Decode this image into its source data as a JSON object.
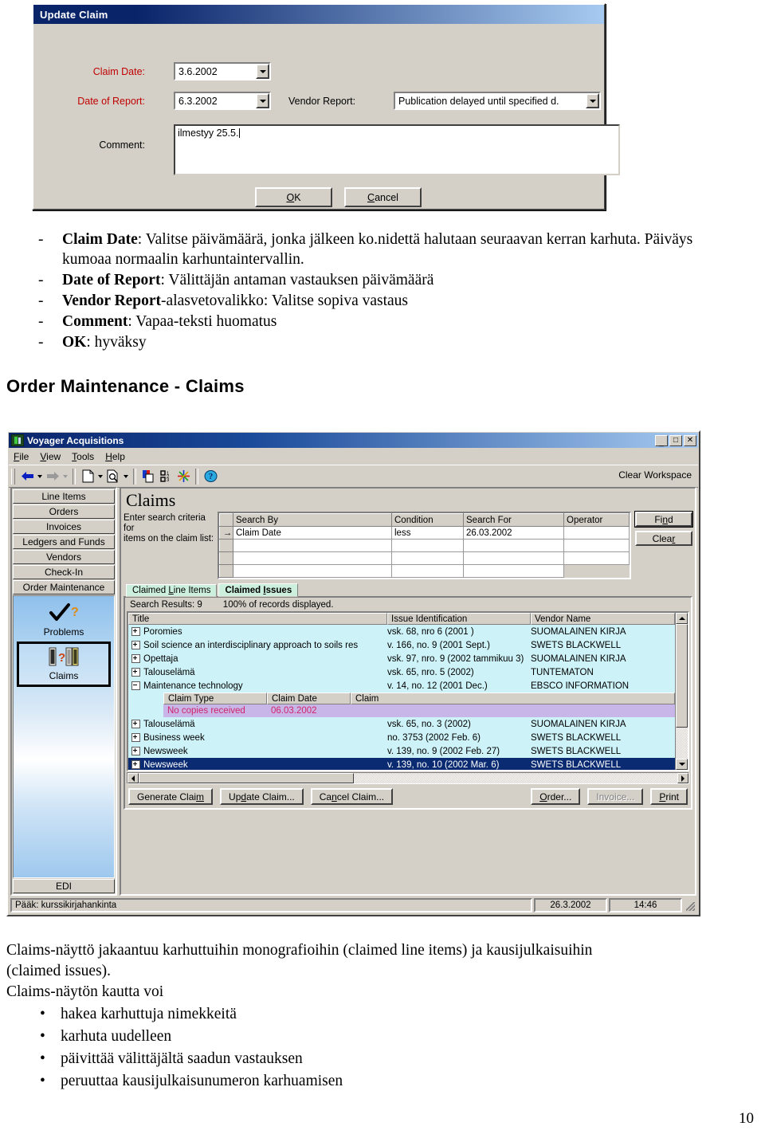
{
  "dialog": {
    "title": "Update Claim",
    "claim_date_label": "Claim Date:",
    "claim_date_value": "3.6.2002",
    "date_of_report_label": "Date of Report:",
    "date_of_report_value": "6.3.2002",
    "vendor_report_label": "Vendor Report:",
    "vendor_report_value": "Publication delayed until specified d.",
    "comment_label": "Comment:",
    "comment_value": "ilmestyy 25.5.",
    "ok_label": "OK",
    "cancel_label": "Cancel"
  },
  "doc_bullets": [
    {
      "dash": "-",
      "bold": "Claim Date",
      "rest": ": Valitse päivämäärä, jonka jälkeen ko.nidettä halutaan seuraavan kerran karhuta. Päiväys kumoaa normaalin karhuntaintervallin."
    },
    {
      "dash": "-",
      "bold": "Date of Report",
      "rest": ": Välittäjän antaman vastauksen päivämäärä"
    },
    {
      "dash": "-",
      "bold": "Vendor Report",
      "rest": "-alasvetovalikko: Valitse sopiva vastaus"
    },
    {
      "dash": "-",
      "bold": "Comment",
      "rest": ": Vapaa-teksti huomatus"
    },
    {
      "dash": "-",
      "bold": "OK",
      "rest": ": hyväksy"
    }
  ],
  "section_heading": "Order Maintenance - Claims",
  "app": {
    "title": "Voyager Acquisitions",
    "window_buttons": {
      "minimize": "_",
      "maximize": "□",
      "close": "✕"
    },
    "menus": [
      "File",
      "View",
      "Tools",
      "Help"
    ],
    "toolbar": {
      "clear_workspace": "Clear Workspace",
      "icons": [
        "back-arrow-icon",
        "forward-arrow-icon",
        "new-record-icon",
        "search-record-icon",
        "copy-record-icon",
        "barcode-icon",
        "asterisk-icon",
        "help-icon"
      ]
    },
    "sidebar": {
      "buttons": [
        "Line Items",
        "Orders",
        "Invoices",
        "Ledgers and Funds",
        "Vendors",
        "Check-In",
        "Order Maintenance"
      ],
      "tiles": [
        {
          "label": "Problems",
          "selected": false
        },
        {
          "label": "Claims",
          "selected": true
        }
      ],
      "edi_label": "EDI"
    },
    "heading": "Claims",
    "search": {
      "hint_line1": "Enter search criteria for",
      "hint_line2": "items on the claim list:",
      "columns": [
        "Search By",
        "Condition",
        "Search For",
        "Operator"
      ],
      "rows": [
        {
          "marker": "→",
          "search_by": "Claim Date",
          "condition": "less",
          "search_for": "26.03.2002",
          "operator": ""
        },
        {
          "marker": "",
          "search_by": "",
          "condition": "",
          "search_for": "",
          "operator": ""
        },
        {
          "marker": "",
          "search_by": "",
          "condition": "",
          "search_for": "",
          "operator": ""
        },
        {
          "marker": "",
          "search_by": "",
          "condition": "",
          "search_for": "",
          "operator": ""
        }
      ],
      "find_label": "Find",
      "clear_label": "Clear"
    },
    "tabs": [
      {
        "label": "Claimed Line Items",
        "active": false
      },
      {
        "label": "Claimed Issues",
        "active": true
      }
    ],
    "results": {
      "label": "Search Results:",
      "count": "9",
      "percent_text": "100% of records displayed.",
      "columns": [
        "Title",
        "Issue Identification",
        "Vendor Name"
      ],
      "rows": [
        {
          "expanded": false,
          "title": "Poromies",
          "issue": "vsk. 68, nro 6 (2001 )",
          "vendor": "SUOMALAINEN KIRJA",
          "selected": false
        },
        {
          "expanded": false,
          "title": "Soil science an interdisciplinary approach to soils res",
          "issue": "v. 166, no. 9 (2001 Sept.)",
          "vendor": "SWETS BLACKWELL",
          "selected": false
        },
        {
          "expanded": false,
          "title": "Opettaja",
          "issue": "vsk. 97, nro. 9 (2002 tammikuu 3)",
          "vendor": "SUOMALAINEN KIRJA",
          "selected": false
        },
        {
          "expanded": false,
          "title": "Talouselämä",
          "issue": "vsk. 65, nro. 5 (2002)",
          "vendor": "TUNTEMATON",
          "selected": false
        },
        {
          "expanded": true,
          "title": "Maintenance technology",
          "issue": "v. 14, no. 12 (2001 Dec.)",
          "vendor": "EBSCO INFORMATION",
          "selected": false
        },
        {
          "expanded": false,
          "title": "Talouselämä",
          "issue": "vsk. 65, no. 3 (2002)",
          "vendor": "SUOMALAINEN KIRJA",
          "selected": false
        },
        {
          "expanded": false,
          "title": "Business week",
          "issue": "no. 3753 (2002 Feb. 6)",
          "vendor": "SWETS BLACKWELL",
          "selected": false
        },
        {
          "expanded": false,
          "title": "Newsweek",
          "issue": "v. 139, no. 9 (2002 Feb. 27)",
          "vendor": "SWETS BLACKWELL",
          "selected": false
        },
        {
          "expanded": false,
          "title": "Newsweek",
          "issue": "v. 139, no. 10 (2002 Mar. 6)",
          "vendor": "SWETS BLACKWELL",
          "selected": true
        }
      ],
      "subgrid": {
        "columns": [
          "Claim Type",
          "Claim Date",
          "Claim"
        ],
        "rows": [
          {
            "claim_type": "No copies received",
            "claim_date": "06.03.2002",
            "claim": ""
          }
        ]
      }
    },
    "action_buttons": [
      {
        "label": "Generate Claim",
        "disabled": false
      },
      {
        "label": "Update Claim...",
        "disabled": false
      },
      {
        "label": "Cancel Claim...",
        "disabled": false
      },
      {
        "label": "Order...",
        "disabled": false
      },
      {
        "label": "Invoice...",
        "disabled": true
      },
      {
        "label": "Print",
        "disabled": false
      }
    ],
    "statusbar": {
      "message": "Pääk: kurssikirjahankinta",
      "date": "26.3.2002",
      "time": "14:46"
    }
  },
  "bottom_text": {
    "paragraph1_line1": "Claims-näyttö jakaantuu karhuttuihin monografioihin (claimed line items) ja kausijulkaisuihin",
    "paragraph1_line2": "(claimed issues).",
    "paragraph2": "Claims-näytön kautta voi",
    "bullets": [
      "hakea karhuttuja nimekkeitä",
      "karhuta uudelleen",
      "päivittää välittäjältä saadun vastauksen",
      "peruuttaa kausijulkaisunumeron karhuamisen"
    ]
  },
  "page_number": "10",
  "colors": {
    "titlebar_dark_blue": "#0a246a",
    "required_label_red": "#c00000",
    "grid_row_cyan": "#cdf2f7",
    "selected_row_blue": "#0a2a72",
    "subgrid_purple": "#c8b6e8",
    "claim_text_pink": "#d0246a",
    "tab_green": "#ccf0dd",
    "window_face": "#d4d0c8"
  }
}
